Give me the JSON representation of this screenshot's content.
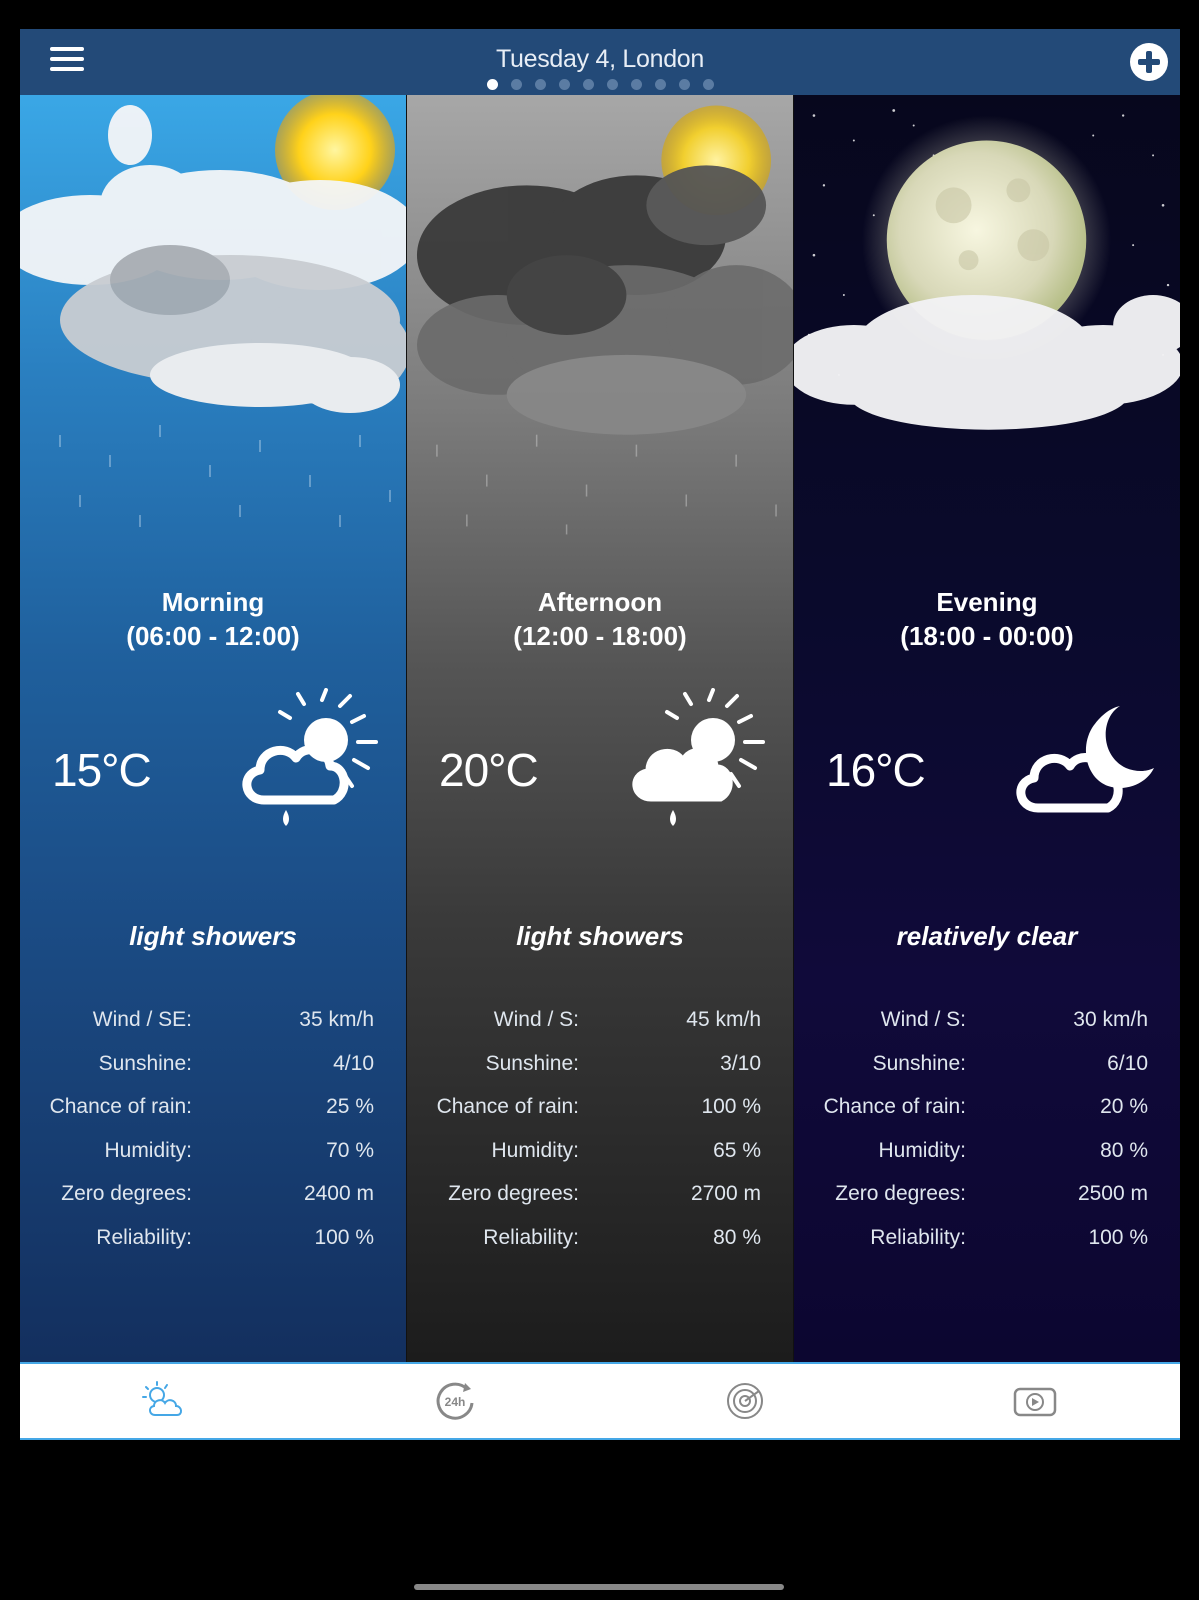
{
  "header": {
    "title": "Tuesday 4, London",
    "page_dots": [
      true,
      false,
      false,
      false,
      false,
      false,
      false,
      false,
      false,
      false
    ],
    "menu_icon": "hamburger-icon",
    "add_icon": "plus-circle-icon"
  },
  "periods": [
    {
      "name": "Morning",
      "range": "(06:00 - 12:00)",
      "temp": "15°C",
      "icon": "cloud-sun-rain-icon",
      "condition": "light showers",
      "stats": [
        {
          "label": "Wind / SE:",
          "value": "35 km/h"
        },
        {
          "label": "Sunshine:",
          "value": "4/10"
        },
        {
          "label": "Chance of rain:",
          "value": "25 %"
        },
        {
          "label": "Humidity:",
          "value": "70 %"
        },
        {
          "label": "Zero degrees:",
          "value": "2400 m"
        },
        {
          "label": "Reliability:",
          "value": "100 %"
        }
      ]
    },
    {
      "name": "Afternoon",
      "range": "(12:00 - 18:00)",
      "temp": "20°C",
      "icon": "cloud-sun-rain-icon",
      "condition": "light showers",
      "stats": [
        {
          "label": "Wind / S:",
          "value": "45 km/h"
        },
        {
          "label": "Sunshine:",
          "value": "3/10"
        },
        {
          "label": "Chance of rain:",
          "value": "100 %"
        },
        {
          "label": "Humidity:",
          "value": "65 %"
        },
        {
          "label": "Zero degrees:",
          "value": "2700 m"
        },
        {
          "label": "Reliability:",
          "value": "80 %"
        }
      ]
    },
    {
      "name": "Evening",
      "range": "(18:00 - 00:00)",
      "temp": "16°C",
      "icon": "cloud-moon-icon",
      "condition": "relatively clear",
      "stats": [
        {
          "label": "Wind / S:",
          "value": "30 km/h"
        },
        {
          "label": "Sunshine:",
          "value": "6/10"
        },
        {
          "label": "Chance of rain:",
          "value": "20 %"
        },
        {
          "label": "Humidity:",
          "value": "80 %"
        },
        {
          "label": "Zero degrees:",
          "value": "2500 m"
        },
        {
          "label": "Reliability:",
          "value": "100 %"
        }
      ]
    }
  ],
  "tabbar": {
    "tabs": [
      {
        "icon": "partly-cloudy-icon",
        "active": true
      },
      {
        "icon": "24h-forecast-icon",
        "active": false
      },
      {
        "icon": "radar-icon",
        "active": false
      },
      {
        "icon": "video-icon",
        "active": false
      }
    ],
    "active_color": "#45a7e6",
    "inactive_color": "#888888",
    "tab_24h_text": "24h"
  },
  "colors": {
    "header_bg": "#234a78",
    "morning_top": "#3aa7e6",
    "afternoon_top": "#a7a7a7",
    "evening_top": "#07071d"
  }
}
